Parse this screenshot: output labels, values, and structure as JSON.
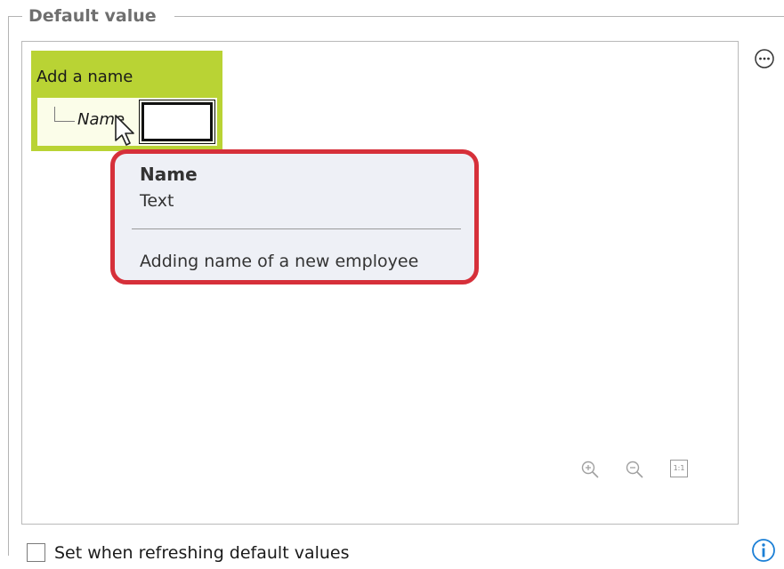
{
  "group": {
    "title": "Default value"
  },
  "node": {
    "title": "Add a name",
    "field_label": "Name",
    "field_value": ""
  },
  "tooltip": {
    "title": "Name",
    "type": "Text",
    "description": "Adding name of a new employee"
  },
  "zoom": {
    "reset_label": "1:1"
  },
  "options": {
    "refresh_checkbox_label": "Set when refreshing default values",
    "refresh_checked": false
  },
  "icons": {
    "zoom_in": "zoom-in-icon",
    "zoom_out": "zoom-out-icon",
    "zoom_reset": "actual-size-icon",
    "more": "more-options-icon",
    "info": "info-icon",
    "cursor": "mouse-pointer-icon"
  },
  "colors": {
    "node_header": "#b9d334",
    "node_body": "#fbfde9",
    "tooltip_highlight": "#d6303a",
    "tooltip_background": "#eef0f6",
    "info_blue": "#1b7fd6"
  }
}
